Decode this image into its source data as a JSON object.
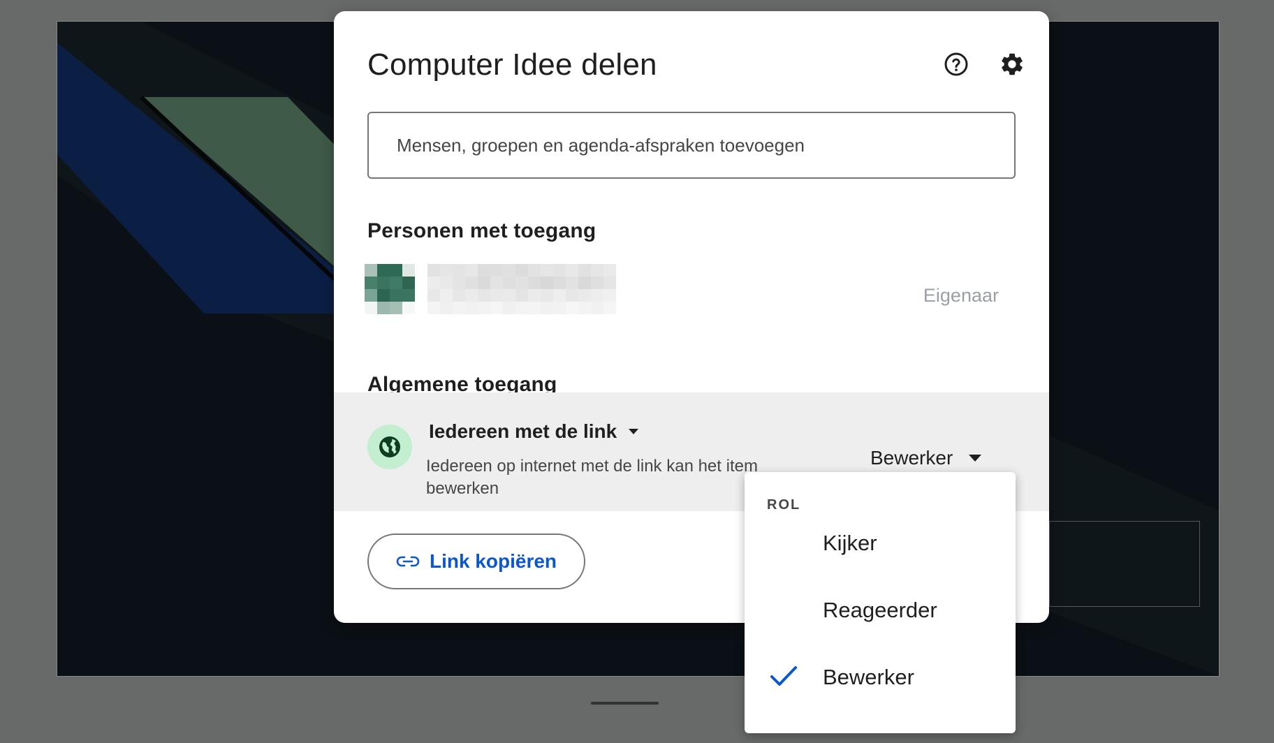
{
  "dialog": {
    "title": "Computer Idee delen",
    "help_icon": "help-circle-icon",
    "settings_icon": "gear-icon",
    "search_placeholder": "Mensen, groepen en agenda-afspraken toevoegen",
    "people_heading": "Personen met toegang",
    "owner": {
      "role": "Eigenaar"
    },
    "general_heading": "Algemene toegang",
    "general_access": {
      "scope_label": "Iedereen met de link",
      "description": "Iedereen op internet met de link kan het item bewerken",
      "role_label": "Bewerker",
      "icon": "globe-icon"
    },
    "copy_link_label": "Link kopiëren"
  },
  "role_menu": {
    "heading": "ROL",
    "items": [
      {
        "label": "Kijker",
        "selected": false
      },
      {
        "label": "Reageerder",
        "selected": false
      },
      {
        "label": "Bewerker",
        "selected": true
      }
    ]
  },
  "colors": {
    "accent": "#0b57d0",
    "globe_bg": "#c4eed0",
    "globe_fg": "#0d3e21",
    "general_row_bg": "#eeeeee",
    "overlay_bg": "#686a69"
  }
}
